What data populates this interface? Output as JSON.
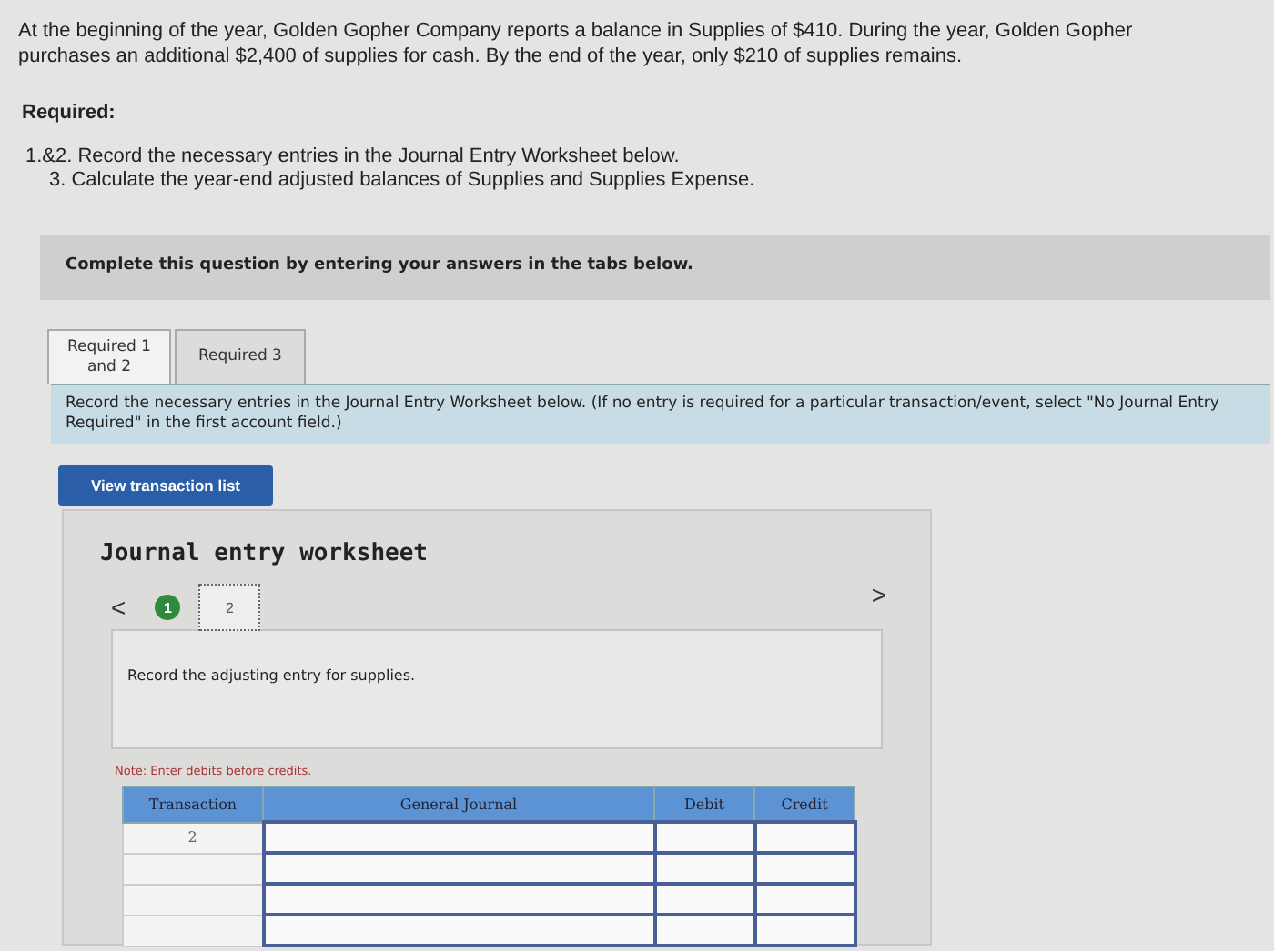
{
  "problem": {
    "text": "At the beginning of the year, Golden Gopher Company reports a balance in Supplies of $410. During the year, Golden Gopher purchases an additional $2,400 of supplies for cash. By the end of the year, only $210 of supplies remains.",
    "heading": "Required:",
    "requirements": [
      {
        "number": "1.&2.",
        "text": "Record the necessary entries in the Journal Entry Worksheet below."
      },
      {
        "number": "3.",
        "text": "Calculate the year-end adjusted balances of Supplies and Supplies Expense."
      }
    ]
  },
  "banner": "Complete this question by entering your answers in the tabs below.",
  "tabs": [
    {
      "label": "Required 1 and 2",
      "selected": true
    },
    {
      "label": "Required 3",
      "selected": false
    }
  ],
  "instructions": "Record the necessary entries in the Journal Entry Worksheet below. (If no entry is required for a particular transaction/event, select \"No Journal Entry Required\" in the first account field.)",
  "view_button": "View transaction list",
  "worksheet": {
    "title": "Journal entry worksheet",
    "prev": "<",
    "next": ">",
    "steps": [
      {
        "label": "1",
        "done": true,
        "selected": false
      },
      {
        "label": "2",
        "done": false,
        "selected": true
      }
    ],
    "prompt": "Record the adjusting entry for supplies.",
    "note": "Note: Enter debits before credits.",
    "columns": [
      "Transaction",
      "General Journal",
      "Debit",
      "Credit"
    ],
    "rows": [
      {
        "transaction": "2"
      },
      {},
      {},
      {}
    ]
  }
}
